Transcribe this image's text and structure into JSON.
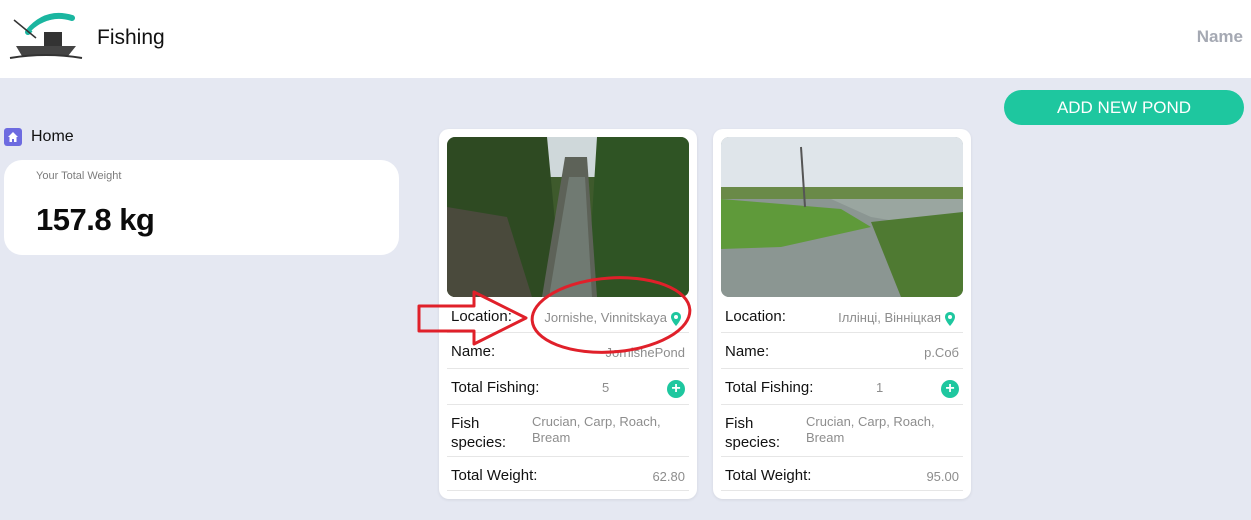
{
  "header": {
    "app_title": "Fishing",
    "user_name": "Name"
  },
  "sidebar": {
    "home_label": "Home"
  },
  "summary": {
    "total_weight_label": "Your Total Weight",
    "total_weight_value": "157.8 kg"
  },
  "actions": {
    "add_pond_label": "ADD NEW POND"
  },
  "ponds": [
    {
      "location_label": "Location:",
      "location": "Jornishe, Vinnitskaya",
      "name_label": "Name:",
      "name": "JornishePond",
      "total_fishing_label": "Total Fishing:",
      "total_fishing": "5",
      "fish_species_label": "Fish species:",
      "fish_species": "Crucian, Carp, Roach, Bream",
      "total_weight_label": "Total Weight:",
      "total_weight": "62.80"
    },
    {
      "location_label": "Location:",
      "location": "Іллінці, Вінніцкая",
      "name_label": "Name:",
      "name": "р.Соб",
      "total_fishing_label": "Total Fishing:",
      "total_fishing": "1",
      "fish_species_label": "Fish species:",
      "fish_species": "Crucian, Carp, Roach, Bream",
      "total_weight_label": "Total Weight:",
      "total_weight": "95.00"
    }
  ],
  "colors": {
    "accent": "#1ec79f",
    "background": "#e5e8f2",
    "annotation": "#e0202a"
  },
  "icons": [
    "home-icon",
    "location-pin-icon",
    "plus-icon"
  ]
}
